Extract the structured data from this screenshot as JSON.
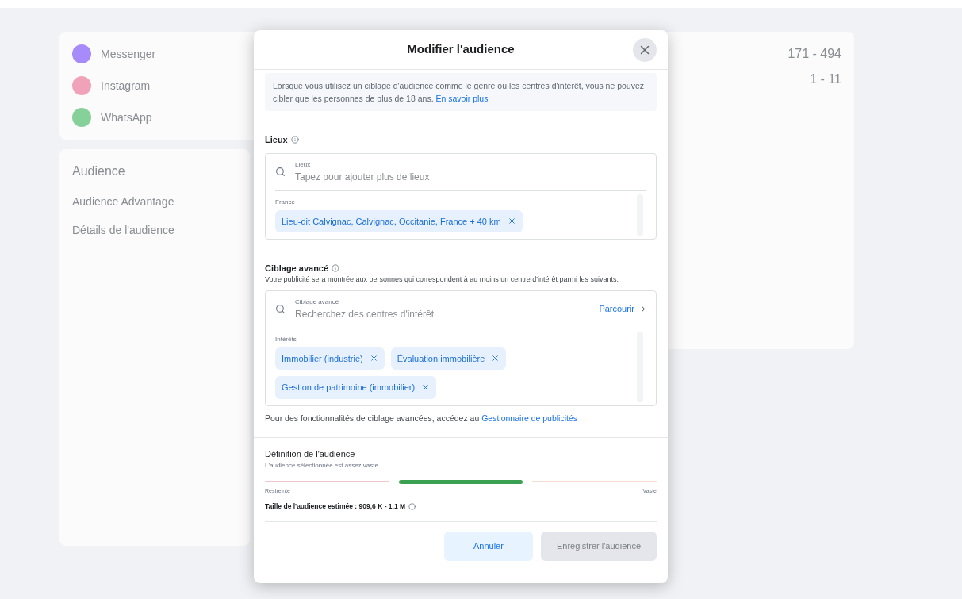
{
  "background": {
    "channels": [
      {
        "name": "Messenger",
        "color": "#a78bfa"
      },
      {
        "name": "Instagram",
        "color": "#f0a3b8"
      },
      {
        "name": "WhatsApp",
        "color": "#86d19a"
      }
    ],
    "audience_title": "Audience",
    "audience_advantage": "Audience Advantage",
    "details_title": "Détails de l'audience",
    "stats": [
      {
        "value": "171 - 494"
      },
      {
        "value": "1 - 11"
      }
    ]
  },
  "dialog": {
    "title": "Modifier l'audience",
    "notice": {
      "text": "Lorsque vous utilisez un ciblage d'audience comme le genre ou les centres d'intérêt, vous ne pouvez cibler que les personnes de plus de 18 ans.",
      "link": "En savoir plus"
    },
    "locations": {
      "label": "Lieux",
      "field_label": "Lieux",
      "placeholder": "Tapez pour ajouter plus de lieux",
      "group": "France",
      "chips": [
        {
          "label": "Lieu-dit Calvignac, Calvignac, Occitanie, France + 40 km"
        }
      ]
    },
    "advanced": {
      "label": "Ciblage avancé",
      "description": "Votre publicité sera montrée aux personnes qui correspondent à au moins un centre d'intérêt parmi les suivants.",
      "field_label": "Ciblage avancé",
      "placeholder": "Recherchez des centres d'intérêt",
      "browse": "Parcourir",
      "group": "Intérêts",
      "chips": [
        {
          "label": "Immobilier (industrie)"
        },
        {
          "label": "Évaluation immobilière"
        },
        {
          "label": "Gestion de patrimoine (immobilier)"
        }
      ],
      "footer": "Pour des fonctionnalités de ciblage avancées, accédez au",
      "footer_link": "Gestionnaire de publicités"
    },
    "definition": {
      "title": "Définition de l'audience",
      "subtitle": "L'audience sélectionnée est assez vaste.",
      "segments": [
        {
          "selected": false,
          "color": "#f3c6cc"
        },
        {
          "selected": true,
          "color": "#3aa153"
        },
        {
          "selected": false,
          "color": "#f7dcd0"
        }
      ],
      "low": "Restreinte",
      "high": "Vaste",
      "estimate": "Taille de l'audience estimée : 909,6 K - 1,1 M"
    },
    "buttons": [
      {
        "label": "Annuler",
        "disabled": false
      },
      {
        "label": "Enregistrer l'audience",
        "disabled": true
      }
    ]
  }
}
